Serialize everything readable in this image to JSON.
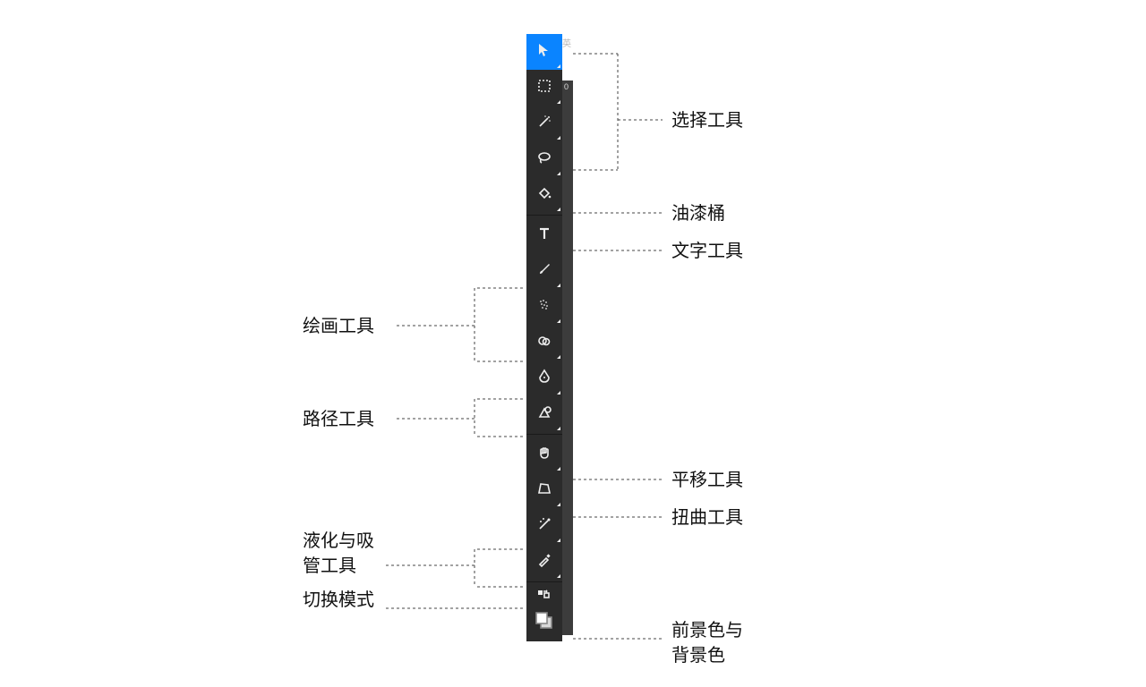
{
  "ime": "英",
  "ruler_zero": "0",
  "labels": {
    "select": "选择工具",
    "paint_bucket": "油漆桶",
    "text_tool": "文字工具",
    "drawing": "绘画工具",
    "path": "路径工具",
    "pan": "平移工具",
    "distort": "扭曲工具",
    "liquify_eyedrop_l1": "液化与吸",
    "liquify_eyedrop_l2": "管工具",
    "toggle_mode": "切换模式",
    "fg_bg_l1": "前景色与",
    "fg_bg_l2": "背景色"
  },
  "tool_icons": {
    "move": "move-icon",
    "marquee": "marquee-icon",
    "wand": "wand-icon",
    "lasso": "lasso-icon",
    "bucket": "bucket-icon",
    "text": "text-icon",
    "brush": "brush-icon",
    "spray": "spray-icon",
    "smudge": "smudge-icon",
    "pen": "pen-icon",
    "shape": "shape-icon",
    "hand": "hand-icon",
    "perspective": "perspective-icon",
    "liquify": "liquify-icon",
    "eyedropper": "eyedropper-icon",
    "swap_mode": "swap-mode-icon",
    "swatches": "color-swatches-icon"
  }
}
